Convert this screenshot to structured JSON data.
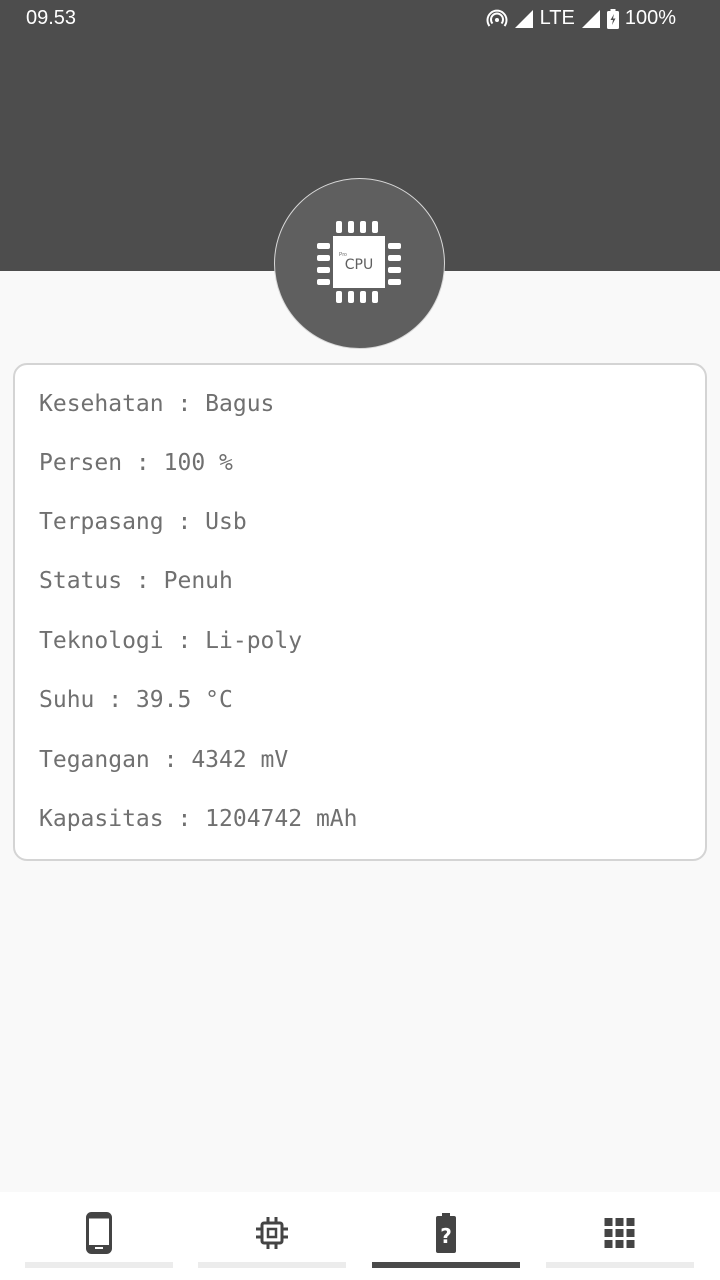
{
  "status_bar": {
    "time": "09.53",
    "network": "LTE",
    "battery": "100%",
    "icons": [
      "hotspot-icon",
      "signal-icon",
      "signal-icon",
      "battery-charging-icon"
    ]
  },
  "header": {
    "logo_label": "CPU",
    "logo_sub": "Pro",
    "logo_icon": "cpu-chip-icon",
    "color": "#4d4d4d"
  },
  "battery_info": {
    "rows": [
      {
        "label": "Kesehatan",
        "value": "Bagus",
        "text": "Kesehatan : Bagus"
      },
      {
        "label": "Persen",
        "value": "100 %",
        "text": "Persen : 100 %"
      },
      {
        "label": "Terpasang",
        "value": "Usb",
        "text": "Terpasang : Usb"
      },
      {
        "label": "Status",
        "value": "Penuh",
        "text": "Status : Penuh"
      },
      {
        "label": "Teknologi",
        "value": "Li-poly",
        "text": "Teknologi : Li-poly"
      },
      {
        "label": "Suhu",
        "value": "39.5 °C",
        "text": "Suhu : 39.5 °C"
      },
      {
        "label": "Tegangan",
        "value": "4342 mV",
        "text": "Tegangan : 4342 mV"
      },
      {
        "label": "Kapasitas",
        "value": "1204742 mAh",
        "text": "Kapasitas : 1204742 mAh"
      }
    ]
  },
  "bottom_nav": {
    "tabs": [
      {
        "name": "device",
        "icon": "smartphone-icon",
        "active": false
      },
      {
        "name": "cpu",
        "icon": "cpu-icon",
        "active": false
      },
      {
        "name": "battery",
        "icon": "battery-unknown-icon",
        "active": true
      },
      {
        "name": "apps",
        "icon": "apps-grid-icon",
        "active": false
      }
    ],
    "active_color": "#4a4a4a"
  }
}
